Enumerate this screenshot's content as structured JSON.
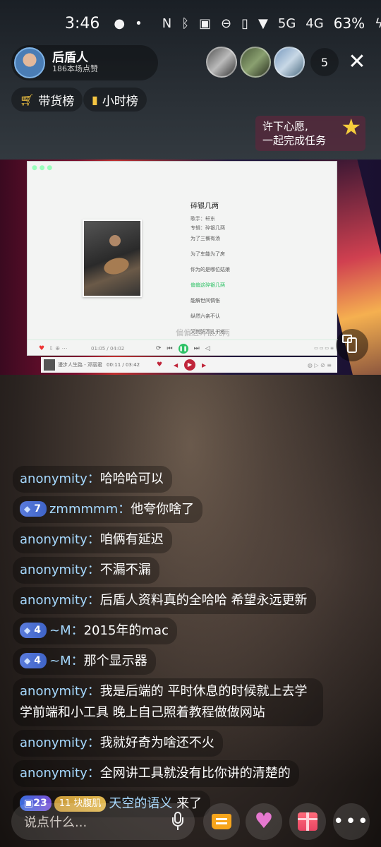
{
  "status_bar": {
    "time": "3:46",
    "battery": "63%",
    "network_1": "5G",
    "network_2": "4G"
  },
  "streamer": {
    "name": "后盾人",
    "likes": "186本场点赞"
  },
  "viewers": {
    "count": "5"
  },
  "ranks": {
    "goods": "带货榜",
    "hourly": "小时榜"
  },
  "wish": {
    "line1": "许下心愿,",
    "line2": "一起完成任务"
  },
  "player": {
    "song_title": "碎银几两",
    "singer_label": "歌手：",
    "singer": "轩东",
    "album_label": "专辑：",
    "album": "碎银几两",
    "lyrics": [
      {
        "text": "为了三餐有汤",
        "active": false
      },
      {
        "text": "为了车能为了房",
        "active": false
      },
      {
        "text": "你为的是哪位姑娘",
        "active": false
      },
      {
        "text": "偏偏这碎银几两",
        "active": true
      },
      {
        "text": "能解世间惆怅",
        "active": false
      },
      {
        "text": "纵然六亲不认",
        "active": false
      },
      {
        "text": "又何妨万孔千疮",
        "active": false
      }
    ],
    "overlay_lyric": "偏偏这碎银几两",
    "time": "01:05 / 04:02",
    "mini_title": "漫步人生路 - 邓丽君",
    "mini_time": "00:11 / 03:42"
  },
  "chat": [
    {
      "user": "anonymity",
      "text": "哈哈哈可以",
      "level": null
    },
    {
      "user": "zmmmmm",
      "text": "他夸你啥了",
      "level": "7"
    },
    {
      "user": "anonymity",
      "text": "咱俩有延迟",
      "level": null
    },
    {
      "user": "anonymity",
      "text": "不漏不漏",
      "level": null
    },
    {
      "user": "anonymity",
      "text": "后盾人资料真的全哈哈 希望永远更新",
      "level": null
    },
    {
      "user": "~M",
      "text": "2015年的mac",
      "level": "4"
    },
    {
      "user": "~M",
      "text": "那个显示器",
      "level": "4"
    },
    {
      "user": "anonymity",
      "text": "我是后端的 平时休息的时候就上去学学前端和小工具 晚上自己照着教程做做网站",
      "level": null
    },
    {
      "user": "anonymity",
      "text": "我就好奇为啥还不火",
      "level": null
    },
    {
      "user": "anonymity",
      "text": "全网讲工具就没有比你讲的清楚的",
      "level": null
    }
  ],
  "join": {
    "level": "23",
    "fan_badge": "块腹肌",
    "fan_level": "11",
    "user": "天空的语义",
    "text": "来了"
  },
  "input": {
    "placeholder": "说点什么..."
  },
  "colors": {
    "username": "#a6d9ff",
    "active_lyric": "#2ec266",
    "accent_gold": "#f5c542"
  }
}
